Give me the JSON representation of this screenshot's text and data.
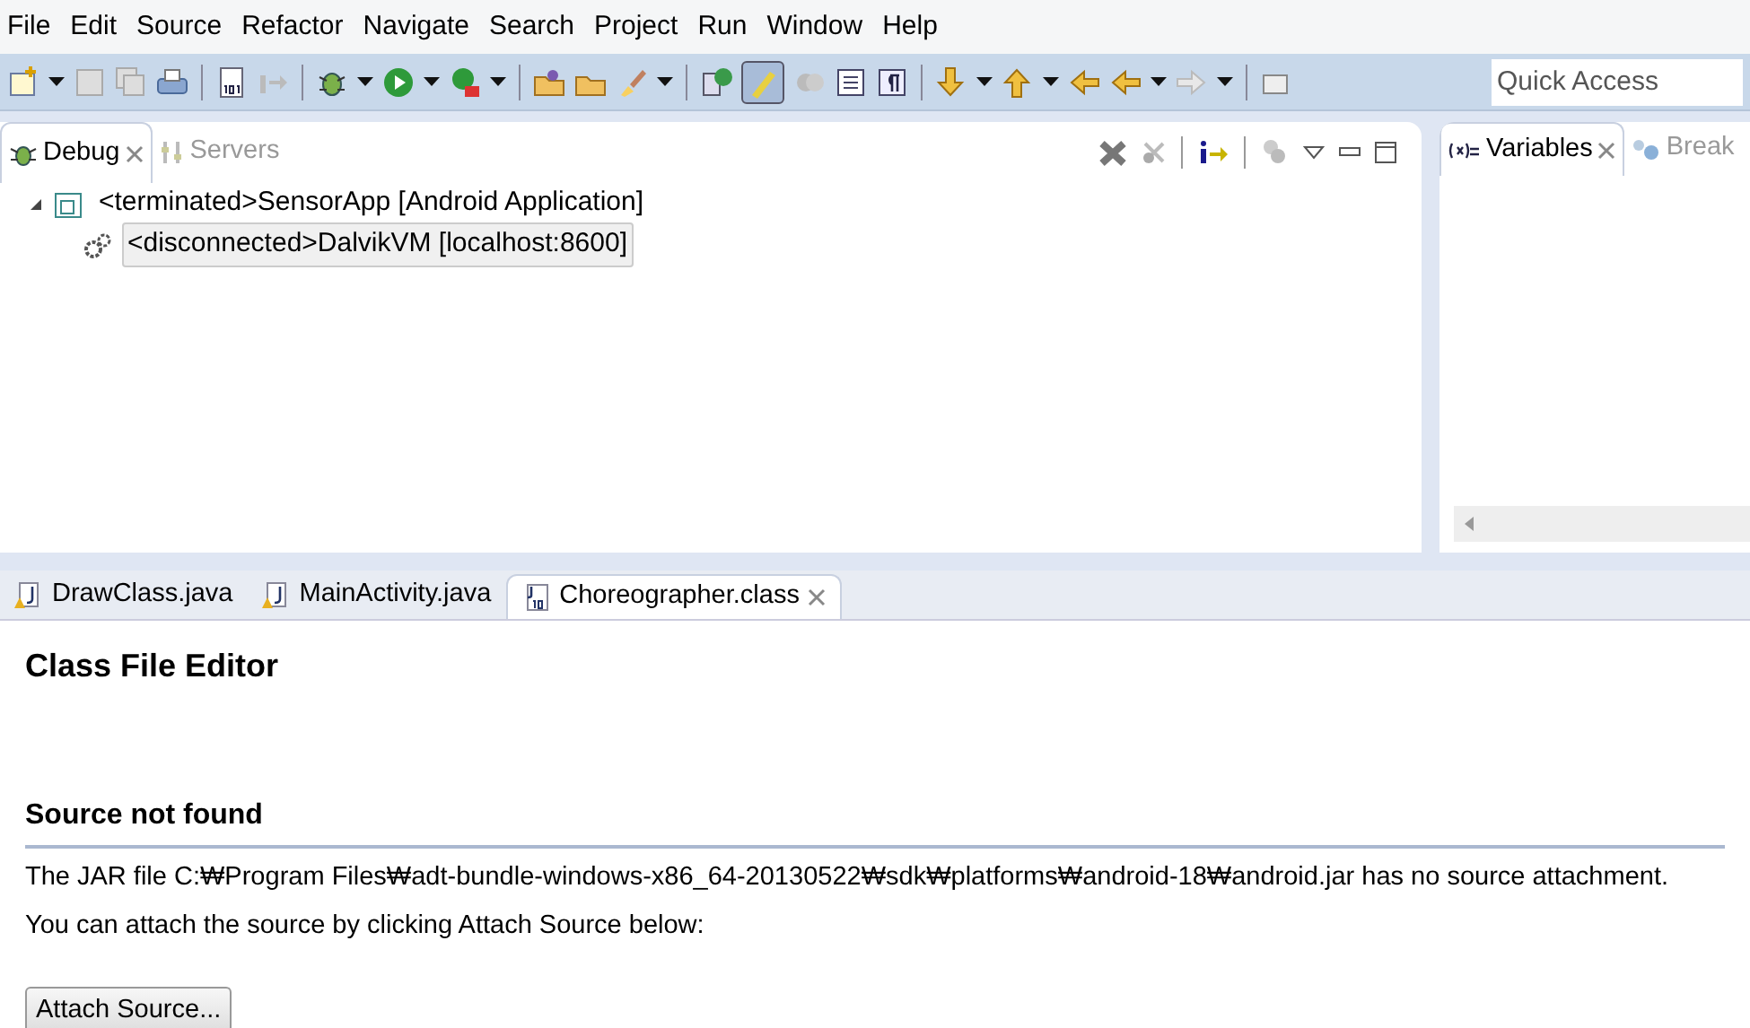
{
  "menu": [
    "File",
    "Edit",
    "Source",
    "Refactor",
    "Navigate",
    "Search",
    "Project",
    "Run",
    "Window",
    "Help"
  ],
  "quick_access": {
    "placeholder": "Quick Access"
  },
  "debug_view": {
    "tabs": [
      {
        "label": "Debug",
        "selected": true
      },
      {
        "label": "Servers",
        "selected": false
      }
    ],
    "tree": [
      {
        "label": "<terminated>SensorApp [Android Application]",
        "expanded": true,
        "selected": false,
        "children": [
          {
            "label": "<disconnected>DalvikVM [localhost:8600]",
            "selected": true
          }
        ]
      }
    ]
  },
  "variables_view": {
    "tabs": [
      {
        "label": "Variables",
        "selected": true
      },
      {
        "label": "Break",
        "selected": false
      }
    ]
  },
  "editor": {
    "tabs": [
      {
        "label": "DrawClass.java",
        "kind": "java",
        "selected": false
      },
      {
        "label": "MainActivity.java",
        "kind": "java",
        "selected": false
      },
      {
        "label": "Choreographer.class",
        "kind": "class",
        "selected": true
      }
    ],
    "title": "Class File Editor",
    "section": "Source not found",
    "message": "The JAR file C:₩Program Files₩adt-bundle-windows-x86_64-20130522₩sdk₩platforms₩android-18₩android.jar has no source attachment.",
    "hint": "You can attach the source by clicking Attach Source below:",
    "button": "Attach Source..."
  }
}
